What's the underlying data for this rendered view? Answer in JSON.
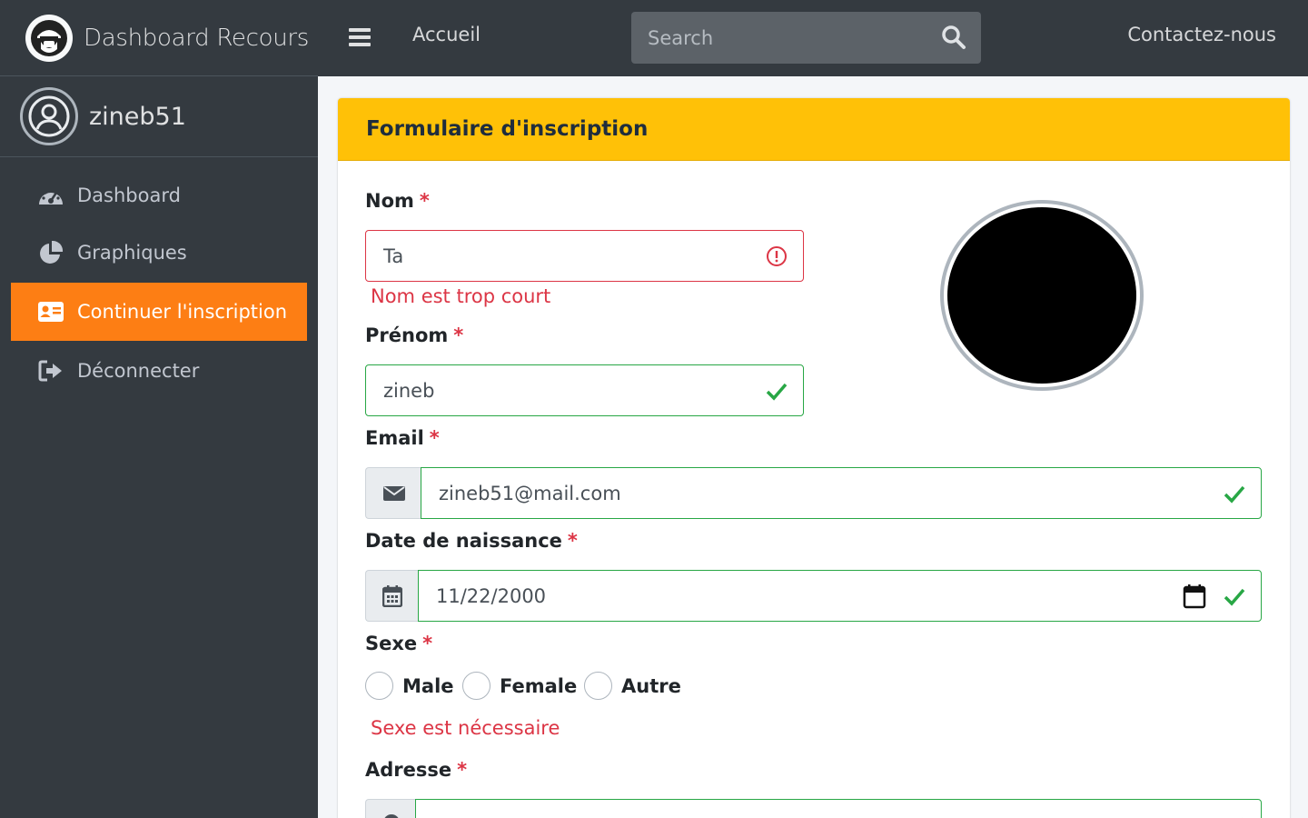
{
  "brand": {
    "title": "Dashboard Recours"
  },
  "user": {
    "name": "zineb51"
  },
  "sidebar": {
    "items": [
      {
        "label": "Dashboard",
        "icon": "tachometer-icon"
      },
      {
        "label": "Graphiques",
        "icon": "pie-chart-icon"
      },
      {
        "label": "Continuer l'inscription",
        "icon": "id-card-icon",
        "active": true
      },
      {
        "label": "Déconnecter",
        "icon": "sign-out-icon"
      }
    ]
  },
  "navbar": {
    "home_label": "Accueil",
    "search_placeholder": "Search",
    "contact_label": "Contactez-nous"
  },
  "form": {
    "title": "Formulaire d'inscription",
    "required_mark": "*",
    "nom": {
      "label": "Nom",
      "value": "Ta",
      "error": "Nom est trop court"
    },
    "prenom": {
      "label": "Prénom",
      "value": "zineb"
    },
    "email": {
      "label": "Email",
      "value": "zineb51@mail.com"
    },
    "date": {
      "label": "Date de naissance",
      "value": "11/22/2000"
    },
    "sexe": {
      "label": "Sexe",
      "options": [
        "Male",
        "Female",
        "Autre"
      ],
      "error": "Sexe est nécessaire"
    },
    "adresse": {
      "label": "Adresse"
    }
  },
  "colors": {
    "accent": "#fd7e14",
    "header": "#ffc107",
    "valid": "#28a745",
    "invalid": "#dc3545",
    "sidebar": "#343a40"
  }
}
